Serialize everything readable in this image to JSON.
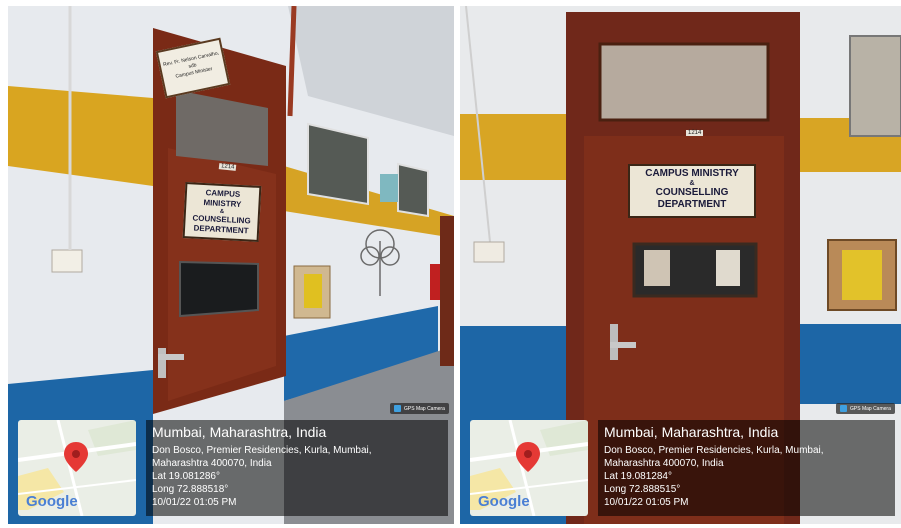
{
  "photos": [
    {
      "city": "Mumbai, Maharashtra, India",
      "address_line1": "Don Bosco, Premier Residencies, Kurla, Mumbai,",
      "address_line2": "Maharashtra 400070, India",
      "lat": "Lat 19.081286°",
      "long": "Long 72.888518°",
      "datetime": "10/01/22 01:05 PM",
      "map_brand": "Google",
      "app_badge": "GPS Map Camera",
      "sign_main": [
        "CAMPUS MINISTRY",
        "&",
        "COUNSELLING",
        "DEPARTMENT"
      ],
      "sign_name": [
        "Rev. Fr. Nelson Carvalho, sdb",
        "Campus Minister"
      ],
      "door_number": "1214"
    },
    {
      "city": "Mumbai, Maharashtra, India",
      "address_line1": "Don Bosco, Premier Residencies, Kurla, Mumbai,",
      "address_line2": "Maharashtra 400070, India",
      "lat": "Lat 19.081284°",
      "long": "Long 72.888515°",
      "datetime": "10/01/22 01:05 PM",
      "map_brand": "Google",
      "app_badge": "GPS Map Camera",
      "sign_main": [
        "CAMPUS MINISTRY",
        "&",
        "COUNSELLING",
        "DEPARTMENT"
      ],
      "door_number": "1214"
    }
  ],
  "colors": {
    "wall": "#e9ecef",
    "yellow_stripe": "#d9a520",
    "blue_stripe": "#1d66a6",
    "door": "#7a2a16",
    "map_pin": "#e53935"
  }
}
